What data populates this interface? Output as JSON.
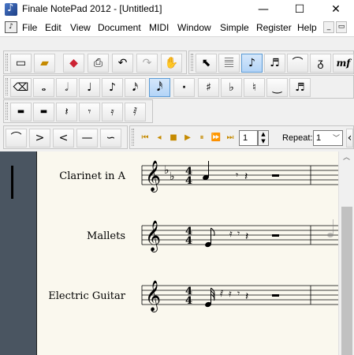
{
  "window": {
    "title": "Finale NotePad 2012 - [Untitled1]",
    "minimize_glyph": "—",
    "maximize_glyph": "☐",
    "close_glyph": "✕"
  },
  "menu": {
    "items": [
      "File",
      "Edit",
      "View",
      "Document",
      "MIDI",
      "Window",
      "Simple",
      "Register",
      "Help"
    ],
    "mdi_minimize": "_",
    "mdi_restore": "▭"
  },
  "toolbar_main": {
    "buttons": [
      {
        "icon": "new-document-icon",
        "glyph": "▭"
      },
      {
        "icon": "open-folder-icon",
        "glyph": "▰"
      },
      {
        "icon": "save-disk-icon",
        "glyph": "◆"
      },
      {
        "icon": "print-icon",
        "glyph": "⎙"
      },
      {
        "icon": "undo-icon",
        "glyph": "↶"
      },
      {
        "icon": "redo-icon",
        "glyph": "↷"
      },
      {
        "icon": "hand-grabber-icon",
        "glyph": "✋"
      }
    ],
    "tools": [
      {
        "icon": "selection-tool-icon",
        "glyph": "⬉"
      },
      {
        "icon": "staff-tool-icon",
        "glyph": "𝄚"
      },
      {
        "icon": "simple-entry-icon",
        "glyph": "♪",
        "active": true
      },
      {
        "icon": "tuplet-tool-icon",
        "glyph": "♬"
      },
      {
        "icon": "smart-shape-icon",
        "glyph": "⌒"
      },
      {
        "icon": "articulation-icon",
        "glyph": "ᵹ"
      },
      {
        "icon": "expression-icon",
        "glyph": "mf"
      }
    ]
  },
  "toolbar_notes": {
    "buttons": [
      {
        "icon": "eraser-icon",
        "glyph": "⌫"
      },
      {
        "icon": "whole-note-icon",
        "glyph": "𝅝"
      },
      {
        "icon": "half-note-icon",
        "glyph": "𝅗𝅥"
      },
      {
        "icon": "quarter-note-icon",
        "glyph": "♩"
      },
      {
        "icon": "eighth-note-icon",
        "glyph": "♪"
      },
      {
        "icon": "sixteenth-note-icon",
        "glyph": "𝅘𝅥𝅯"
      },
      {
        "icon": "thirty-second-note-icon",
        "glyph": "𝅘𝅥𝅰",
        "active": true
      },
      {
        "icon": "augmentation-dot-icon",
        "glyph": "·"
      },
      {
        "icon": "sharp-icon",
        "glyph": "♯"
      },
      {
        "icon": "flat-icon",
        "glyph": "♭"
      },
      {
        "icon": "natural-icon",
        "glyph": "♮"
      },
      {
        "icon": "tie-icon",
        "glyph": "‿"
      },
      {
        "icon": "triplet-icon",
        "glyph": "♬"
      }
    ],
    "close_glyph": "×"
  },
  "toolbar_rests": {
    "buttons": [
      {
        "icon": "whole-rest-icon",
        "glyph": "▬"
      },
      {
        "icon": "half-rest-icon",
        "glyph": "▬"
      },
      {
        "icon": "quarter-rest-icon",
        "glyph": "𝄽"
      },
      {
        "icon": "eighth-rest-icon",
        "glyph": "𝄾"
      },
      {
        "icon": "sixteenth-rest-icon",
        "glyph": "𝄿"
      },
      {
        "icon": "thirty-second-rest-icon",
        "glyph": "𝅀"
      }
    ]
  },
  "toolbar_shapes": {
    "buttons": [
      {
        "icon": "slur-icon",
        "glyph": "⌒"
      },
      {
        "icon": "decrescendo-icon",
        "glyph": ">"
      },
      {
        "icon": "crescendo-icon",
        "glyph": "<"
      },
      {
        "icon": "line-icon",
        "glyph": "—"
      },
      {
        "icon": "custom-line-icon",
        "glyph": "∽"
      }
    ]
  },
  "playback": {
    "buttons": [
      {
        "icon": "rewind-start-icon",
        "glyph": "⏮"
      },
      {
        "icon": "step-back-icon",
        "glyph": "◂"
      },
      {
        "icon": "stop-icon",
        "glyph": "■"
      },
      {
        "icon": "play-icon",
        "glyph": "▶"
      },
      {
        "icon": "pause-icon",
        "glyph": "⏸"
      },
      {
        "icon": "fast-forward-icon",
        "glyph": "⏩"
      },
      {
        "icon": "end-icon",
        "glyph": "⏭"
      }
    ],
    "measure_value": "1",
    "repeat_label": "Repeat:",
    "repeat_value": "1"
  },
  "score": {
    "staves": [
      {
        "name": "Clarinet in A"
      },
      {
        "name": "Mallets"
      },
      {
        "name": "Electric Guitar"
      }
    ],
    "time_signature": {
      "top": "4",
      "bottom": "4"
    }
  },
  "colors": {
    "page": "#faf8ee",
    "left_panel": "#4a5561",
    "active_tool": "#b3d4f7",
    "playback_accent": "#c58a00"
  }
}
